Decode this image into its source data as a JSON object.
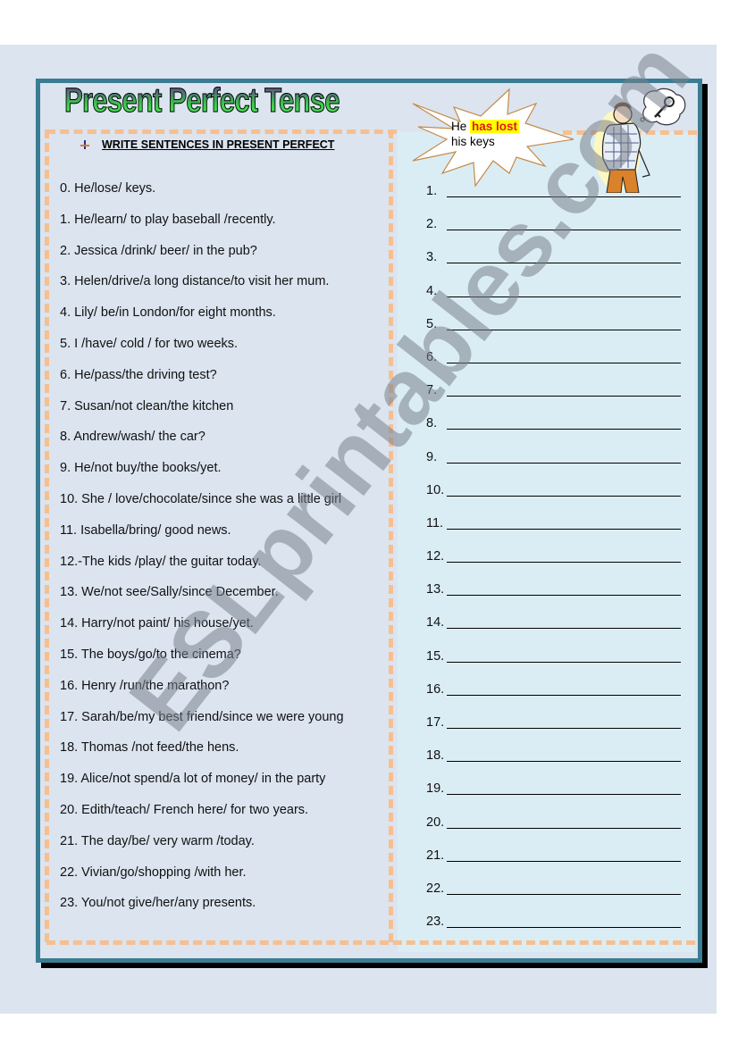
{
  "worksheet": {
    "title": "Present Perfect Tense",
    "instruction": "WRITE SENTENCES IN PRESENT  PERFECT",
    "instruction_icon": "bullet-arrow-icon",
    "watermark": "ESLprintables.com",
    "example_bubble": {
      "before": "He ",
      "highlight": "has lost",
      "after_line": "his keys"
    },
    "illustration": "worried-man-thinking-of-keys",
    "sentences": [
      "0. He/lose/ keys.",
      "1. He/learn/ to play baseball /recently.",
      "2. Jessica /drink/ beer/ in the pub?",
      "3. Helen/drive/a long distance/to visit her mum.",
      "4. Lily/ be/in London/for eight months.",
      "5. I /have/ cold / for two weeks.",
      "6. He/pass/the driving test?",
      "7. Susan/not clean/the kitchen",
      "8. Andrew/wash/ the car?",
      "9. He/not buy/the books/yet.",
      "10. She / love/chocolate/since she was a little girl",
      "11. Isabella/bring/ good news.",
      "12.-The kids /play/ the guitar today.",
      "13. We/not see/Sally/since December.",
      "14. Harry/not paint/ his house/yet.",
      "15. The boys/go/to the cinema?",
      "16. Henry /run/the marathon?",
      "17. Sarah/be/my best friend/since we were young",
      "18. Thomas /not feed/the hens.",
      "19. Alice/not spend/a lot of money/ in the party",
      "20. Edith/teach/ French here/ for two years.",
      "21. The day/be/ very warm /today.",
      "22. Vivian/go/shopping /with her.",
      "23. You/not give/her/any presents."
    ],
    "answer_numbers": [
      "1.",
      "2.",
      "3.",
      "4.",
      "5.",
      "6.",
      "7.",
      "8.",
      "9.",
      "10.",
      "11.",
      "12.",
      "13.",
      "14.",
      "15.",
      "16.",
      "17.",
      "18.",
      "19.",
      "20.",
      "21.",
      "22.",
      "23."
    ],
    "colors": {
      "frame": "#3a7d93",
      "dashes": "#f7bf8f",
      "left_bg": "#dbe4ef",
      "right_bg": "#dbedf4",
      "highlight_bg": "#ffff00",
      "highlight_text": "#e01a1a"
    }
  }
}
